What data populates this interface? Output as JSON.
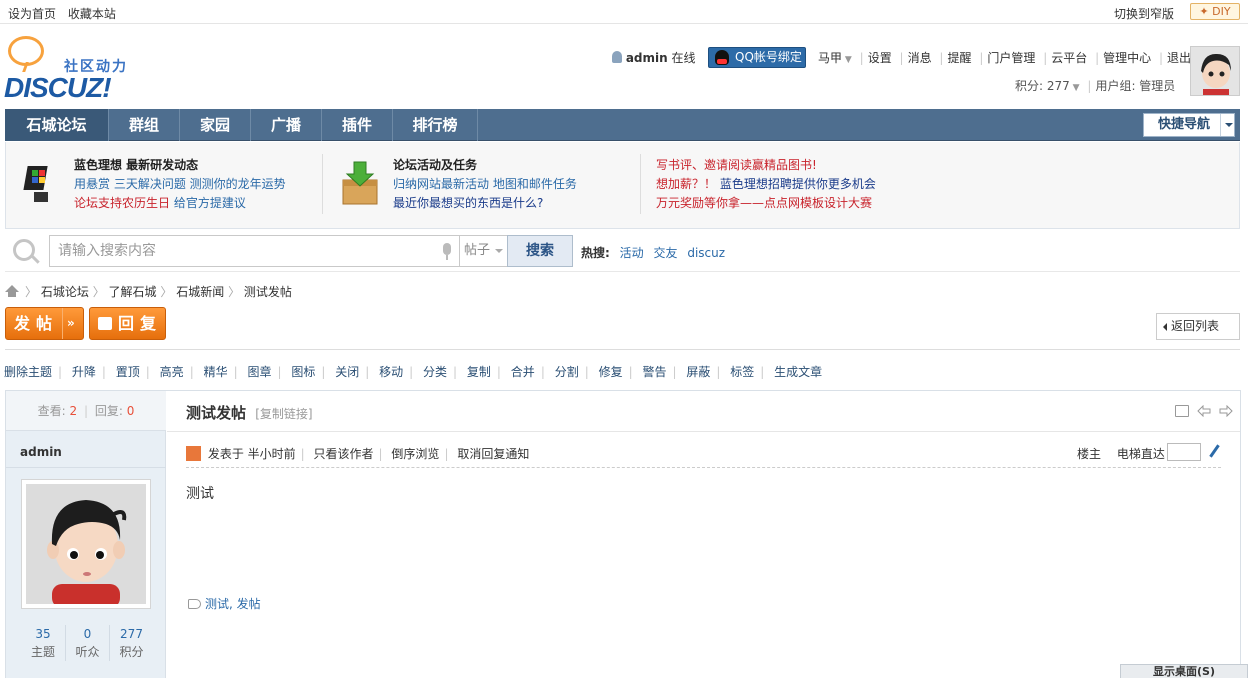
{
  "topbar": {
    "set_home": "设为首页",
    "bookmark": "收藏本站",
    "switch_narrow": "切换到窄版",
    "diy": "DIY"
  },
  "logo": {
    "tagline": "社区动力",
    "wordmark": "DISCUZ!"
  },
  "user": {
    "name": "admin",
    "online": "在线",
    "qq_bind": "QQ帐号绑定",
    "vest": "马甲",
    "links": [
      "设置",
      "消息",
      "提醒",
      "门户管理",
      "云平台",
      "管理中心",
      "退出"
    ],
    "credits": "积分: 277",
    "group": "用户组: 管理员"
  },
  "nav": {
    "items": [
      "石城论坛",
      "群组",
      "家园",
      "广播",
      "插件",
      "排行榜"
    ],
    "quick": "快捷导航"
  },
  "promo": {
    "col1": {
      "title": "蓝色理想 最新研发动态",
      "line1": "用悬赏 三天解决问题 测测你的龙年运势",
      "line2a": "论坛支持农历生日",
      "line2b": "给官方提建议"
    },
    "col2": {
      "title": "论坛活动及任务",
      "line1": "归纳网站最新活动 地图和邮件任务",
      "line2": "最近你最想买的东西是什么?"
    },
    "col3": {
      "line1": "写书评、邀请阅读赢精品图书!",
      "line2a": "想加薪？！",
      "line2b": "蓝色理想招聘提供你更多机会",
      "line3": "万元奖励等你拿——点点网模板设计大赛"
    }
  },
  "search": {
    "placeholder": "请输入搜索内容",
    "type": "帖子",
    "button": "搜索",
    "hot_label": "热搜:",
    "hot": [
      "活动",
      "交友",
      "discuz"
    ]
  },
  "breadcrumb": [
    "石城论坛",
    "了解石城",
    "石城新闻",
    "测试发帖"
  ],
  "actions": {
    "post": "发帖",
    "reply": "回复",
    "back": "返回列表"
  },
  "modbar": [
    "删除主题",
    "升降",
    "置顶",
    "高亮",
    "精华",
    "图章",
    "图标",
    "关闭",
    "移动",
    "分类",
    "复制",
    "合并",
    "分割",
    "修复",
    "警告",
    "屏蔽",
    "标签",
    "生成文章"
  ],
  "thread": {
    "views_label": "查看:",
    "views": "2",
    "replies_label": "回复:",
    "replies": "0",
    "title": "测试发帖",
    "copy_link": "[复制链接]",
    "author": "admin",
    "posted": "发表于 半小时前",
    "only_author": "只看该作者",
    "reverse": "倒序浏览",
    "cancel_notify": "取消回复通知",
    "floor": "楼主",
    "elevator": "电梯直达",
    "content": "测试",
    "tags": "测试, 发帖",
    "stats": [
      {
        "value": "35",
        "label": "主题"
      },
      {
        "value": "0",
        "label": "听众"
      },
      {
        "value": "277",
        "label": "积分"
      }
    ]
  },
  "desktop": "显示桌面(S)"
}
